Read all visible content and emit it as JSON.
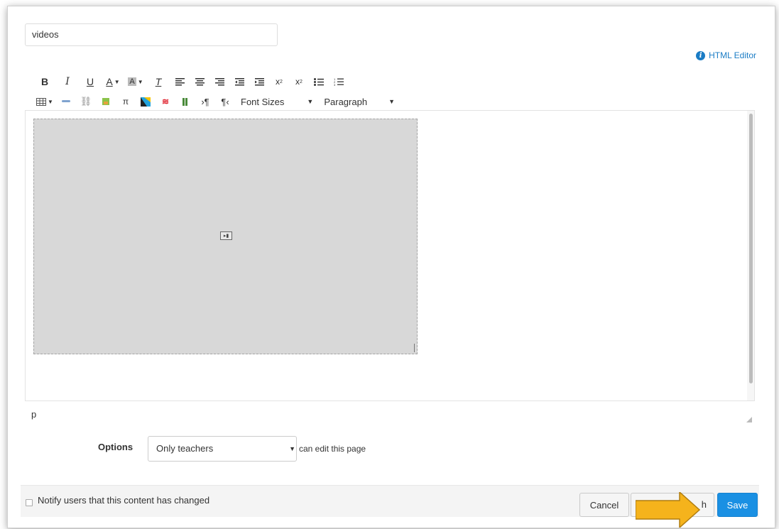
{
  "title_input": {
    "value": "videos"
  },
  "html_editor": {
    "label": "HTML Editor"
  },
  "toolbar": {
    "row1": [
      {
        "name": "bold-button",
        "glyph": "B"
      },
      {
        "name": "italic-button",
        "glyph": "I"
      },
      {
        "name": "underline-button",
        "glyph": "U"
      },
      {
        "name": "text-color-button",
        "glyph": "A"
      },
      {
        "name": "background-color-button",
        "glyph": "A"
      },
      {
        "name": "clear-formatting-button",
        "glyph": "Tₓ"
      },
      {
        "name": "align-left-button",
        "glyph": "≡"
      },
      {
        "name": "align-center-button",
        "glyph": "≡"
      },
      {
        "name": "align-right-button",
        "glyph": "≡"
      },
      {
        "name": "outdent-button",
        "glyph": "⇤"
      },
      {
        "name": "indent-button",
        "glyph": "⇥"
      },
      {
        "name": "superscript-button",
        "glyph": "x²"
      },
      {
        "name": "subscript-button",
        "glyph": "x₂"
      },
      {
        "name": "bullet-list-button",
        "glyph": "☰"
      },
      {
        "name": "numbered-list-button",
        "glyph": "⒈"
      }
    ],
    "font_sizes": "Font Sizes",
    "paragraph": "Paragraph"
  },
  "editor": {
    "path": "p"
  },
  "options": {
    "label": "Options",
    "selected": "Only teachers",
    "suffix": "can edit this page"
  },
  "footer": {
    "notify_label": "Notify users that this content has changed",
    "cancel": "Cancel",
    "publish_partial": "h",
    "save": "Save"
  },
  "colors": {
    "accent": "#1a90e3",
    "link": "#1a7cc5",
    "arrow": "#f5b31c"
  }
}
